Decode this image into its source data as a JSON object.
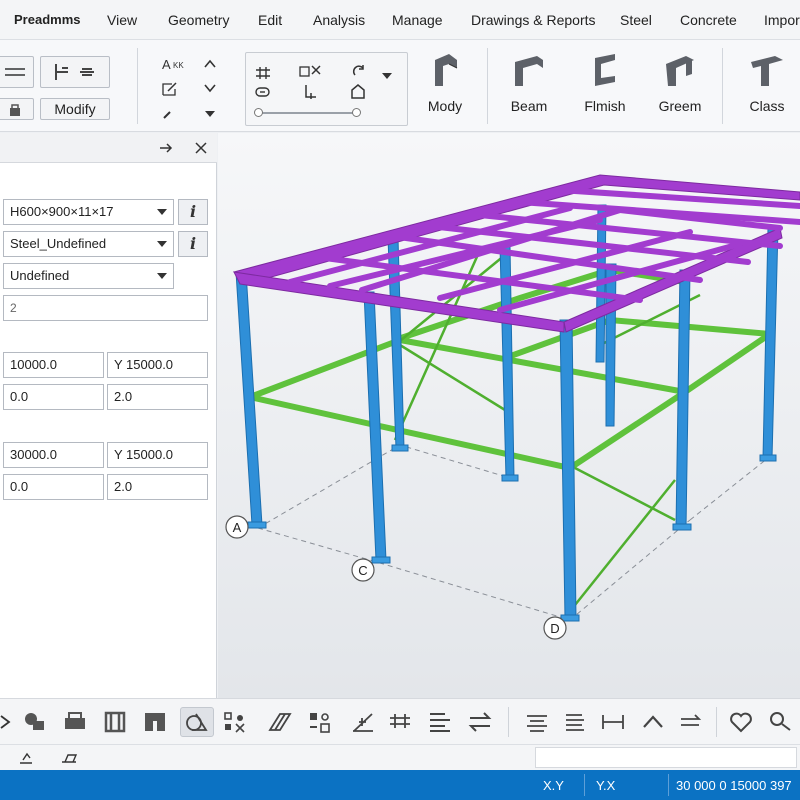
{
  "menu": {
    "app_title": "Preadmms",
    "items": [
      "View",
      "Geometry",
      "Edit",
      "Analysis",
      "Manage",
      "Drawings & Reports",
      "Steel",
      "Concrete",
      "Impor"
    ]
  },
  "ribbon": {
    "modify_label": "Modify",
    "text_tool_label": "AAk",
    "big_buttons": [
      {
        "label": "Mody",
        "icon": "mody-icon"
      },
      {
        "label": "Beam",
        "icon": "beam-icon"
      },
      {
        "label": "Flmish",
        "icon": "flmish-icon"
      },
      {
        "label": "Greem",
        "icon": "greem-icon"
      },
      {
        "label": "Class",
        "icon": "class-icon"
      }
    ],
    "slider_value": 0.95
  },
  "panel": {
    "profile": "H600×900×11×17",
    "material": "Steel_Undefined",
    "class": "Undefined",
    "name_placeholder": "2",
    "start": {
      "x": "10000.0",
      "y": "Y 15000.0",
      "z1": "0.0",
      "z2": "2.0"
    },
    "end": {
      "x": "30000.0",
      "y": "Y 15000.0",
      "z1": "0.0",
      "z2": "2.0"
    }
  },
  "viewport": {
    "grid_labels": [
      "A",
      "C",
      "D"
    ],
    "colors": {
      "column": "#2f8fd8",
      "roof_beam": "#a23ccf",
      "floor_beam": "#6fcf4a",
      "background": "#eceef1"
    }
  },
  "statusbar": {
    "coord1": "X.Y",
    "coord2": "Y.X",
    "readout": "30 000 0 15000 397"
  }
}
